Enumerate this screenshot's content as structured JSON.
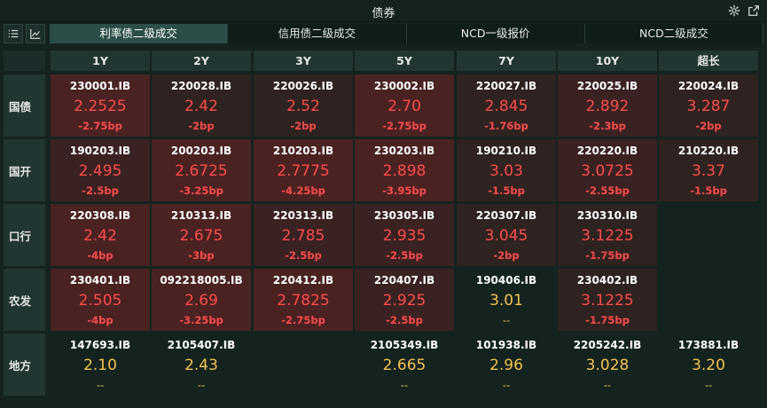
{
  "window": {
    "title": "债券"
  },
  "icons": {
    "settings": "gear-icon",
    "popout": "external-link-icon",
    "list_view": "list-icon",
    "chart_view": "line-chart-icon"
  },
  "tabs": [
    {
      "label": "利率债二级成交",
      "active": true
    },
    {
      "label": "信用债二级成交",
      "active": false
    },
    {
      "label": "NCD一级报价",
      "active": false
    },
    {
      "label": "NCD二级成交",
      "active": false
    }
  ],
  "columns": [
    "1Y",
    "2Y",
    "3Y",
    "5Y",
    "7Y",
    "10Y",
    "超长"
  ],
  "rows": [
    {
      "label": "国债",
      "cells": [
        {
          "code": "230001.IB",
          "rate": "2.2525",
          "change": "-2.75bp",
          "tone": "r1"
        },
        {
          "code": "220028.IB",
          "rate": "2.42",
          "change": "-2bp",
          "tone": "r3"
        },
        {
          "code": "220026.IB",
          "rate": "2.52",
          "change": "-2bp",
          "tone": "r3"
        },
        {
          "code": "230002.IB",
          "rate": "2.70",
          "change": "-2.75bp",
          "tone": "r1"
        },
        {
          "code": "220027.IB",
          "rate": "2.845",
          "change": "-1.76bp",
          "tone": "r3"
        },
        {
          "code": "220025.IB",
          "rate": "2.892",
          "change": "-2.3bp",
          "tone": "r2"
        },
        {
          "code": "220024.IB",
          "rate": "3.287",
          "change": "-2bp",
          "tone": "r3"
        }
      ]
    },
    {
      "label": "国开",
      "cells": [
        {
          "code": "190203.IB",
          "rate": "2.495",
          "change": "-2.5bp",
          "tone": "r2"
        },
        {
          "code": "200203.IB",
          "rate": "2.6725",
          "change": "-3.25bp",
          "tone": "r1"
        },
        {
          "code": "210203.IB",
          "rate": "2.7775",
          "change": "-4.25bp",
          "tone": "r1"
        },
        {
          "code": "230203.IB",
          "rate": "2.898",
          "change": "-3.95bp",
          "tone": "r1"
        },
        {
          "code": "190210.IB",
          "rate": "3.03",
          "change": "-1.5bp",
          "tone": "r3"
        },
        {
          "code": "220220.IB",
          "rate": "3.0725",
          "change": "-2.55bp",
          "tone": "r2"
        },
        {
          "code": "210220.IB",
          "rate": "3.37",
          "change": "-1.5bp",
          "tone": "r3"
        }
      ]
    },
    {
      "label": "口行",
      "cells": [
        {
          "code": "220308.IB",
          "rate": "2.42",
          "change": "-4bp",
          "tone": "r1"
        },
        {
          "code": "210313.IB",
          "rate": "2.675",
          "change": "-3bp",
          "tone": "r1"
        },
        {
          "code": "220313.IB",
          "rate": "2.785",
          "change": "-2.5bp",
          "tone": "r2"
        },
        {
          "code": "230305.IB",
          "rate": "2.935",
          "change": "-2.5bp",
          "tone": "r2"
        },
        {
          "code": "220307.IB",
          "rate": "3.045",
          "change": "-2bp",
          "tone": "r3"
        },
        {
          "code": "230310.IB",
          "rate": "3.1225",
          "change": "-1.75bp",
          "tone": "r3"
        },
        null
      ]
    },
    {
      "label": "农发",
      "cells": [
        {
          "code": "230401.IB",
          "rate": "2.505",
          "change": "-4bp",
          "tone": "r1"
        },
        {
          "code": "092218005.IB",
          "rate": "2.69",
          "change": "-3.25bp",
          "tone": "r1"
        },
        {
          "code": "220412.IB",
          "rate": "2.7825",
          "change": "-2.75bp",
          "tone": "r1"
        },
        {
          "code": "220407.IB",
          "rate": "2.925",
          "change": "-2.5bp",
          "tone": "r2"
        },
        {
          "code": "190406.IB",
          "rate": "3.01",
          "change": "--",
          "tone": "neutral"
        },
        {
          "code": "230402.IB",
          "rate": "3.1225",
          "change": "-1.75bp",
          "tone": "r3"
        },
        null
      ]
    },
    {
      "label": "地方",
      "cells": [
        {
          "code": "147693.IB",
          "rate": "2.10",
          "change": "--",
          "tone": "neutral"
        },
        {
          "code": "2105407.IB",
          "rate": "2.43",
          "change": "--",
          "tone": "neutral"
        },
        null,
        {
          "code": "2105349.IB",
          "rate": "2.665",
          "change": "--",
          "tone": "neutral"
        },
        {
          "code": "101938.IB",
          "rate": "2.96",
          "change": "--",
          "tone": "neutral"
        },
        {
          "code": "2205242.IB",
          "rate": "3.028",
          "change": "--",
          "tone": "neutral"
        },
        {
          "code": "173881.IB",
          "rate": "3.20",
          "change": "--",
          "tone": "neutral"
        }
      ]
    }
  ],
  "colors": {
    "up_red": "#ff4b4b",
    "neutral_yellow": "#f2c14e",
    "active_tab": "#2b4f48",
    "background": "#142320"
  }
}
